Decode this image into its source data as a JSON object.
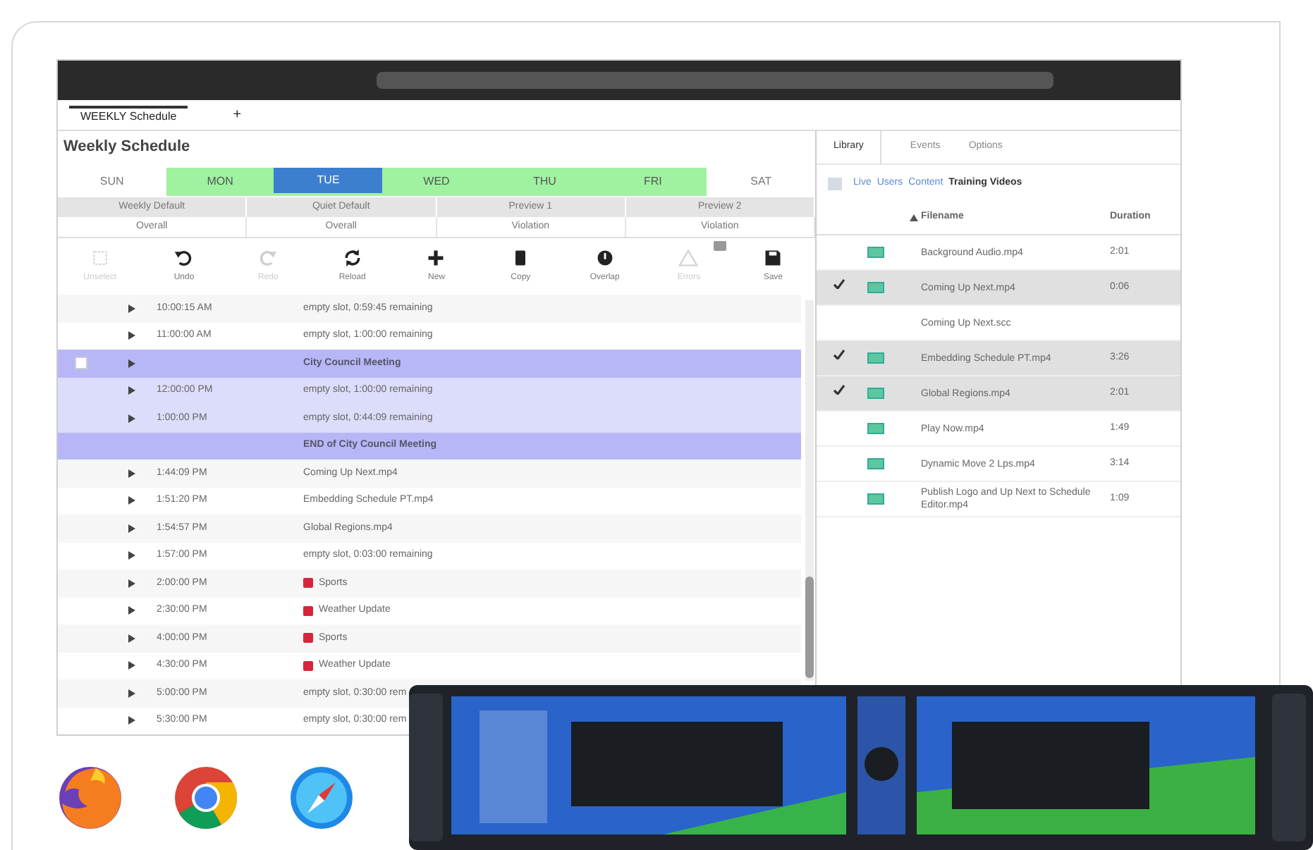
{
  "app_tabs": [
    {
      "label": "WEEKLY Schedule",
      "selected": true
    },
    {
      "label": "+",
      "selected": false
    }
  ],
  "schedule": {
    "title": "Weekly Schedule",
    "days": [
      {
        "label": "SUN",
        "selected": false,
        "scheduled": false
      },
      {
        "label": "MON",
        "selected": false,
        "scheduled": true
      },
      {
        "label": "TUE",
        "selected": true,
        "scheduled": true
      },
      {
        "label": "WED",
        "selected": false,
        "scheduled": true
      },
      {
        "label": "THU",
        "selected": false,
        "scheduled": true
      },
      {
        "label": "FRI",
        "selected": false,
        "scheduled": true
      },
      {
        "label": "SAT",
        "selected": false,
        "scheduled": false
      }
    ],
    "profiles": [
      "Weekly Default",
      "Quiet Default",
      "Preview 1",
      "Preview 2"
    ],
    "profile_states": [
      "Overall",
      "Overall",
      "Violation",
      "Violation"
    ],
    "toolbar": [
      {
        "label": "Unselect",
        "disabled": true
      },
      {
        "label": "Undo",
        "disabled": false
      },
      {
        "label": "Redo",
        "disabled": true
      },
      {
        "label": "Reload",
        "disabled": false
      },
      {
        "label": "New",
        "disabled": false
      },
      {
        "label": "Copy",
        "disabled": false
      },
      {
        "label": "Overlap",
        "disabled": false
      },
      {
        "label": "Errors",
        "disabled": true
      },
      {
        "label": "Save",
        "disabled": false
      }
    ],
    "rows": [
      {
        "kind": "item",
        "time": "10:00:15 AM",
        "title": "empty slot, 0:59:45 remaining",
        "flag": false
      },
      {
        "kind": "item",
        "time": "11:00:00 AM",
        "title": "empty slot, 1:00:00 remaining",
        "flag": false
      },
      {
        "kind": "block_start",
        "title": "City Council Meeting",
        "checked": false
      },
      {
        "kind": "block_item",
        "time": "12:00:00 PM",
        "title": "empty slot, 1:00:00 remaining",
        "flag": false
      },
      {
        "kind": "block_item",
        "time": "1:00:00 PM",
        "title": "empty slot, 0:44:09 remaining",
        "flag": false
      },
      {
        "kind": "block_end",
        "title": "END of City Council Meeting"
      },
      {
        "kind": "item",
        "time": "1:44:09 PM",
        "title": "Coming Up Next.mp4",
        "flag": false
      },
      {
        "kind": "item",
        "time": "1:51:20 PM",
        "title": "Embedding Schedule PT.mp4",
        "flag": false
      },
      {
        "kind": "item",
        "time": "1:54:57 PM",
        "title": "Global Regions.mp4",
        "flag": false
      },
      {
        "kind": "item",
        "time": "1:57:00 PM",
        "title": "empty slot, 0:03:00 remaining",
        "flag": false
      },
      {
        "kind": "item",
        "time": "2:00:00 PM",
        "title": "Sports",
        "flag": true
      },
      {
        "kind": "item",
        "time": "2:30:00 PM",
        "title": "Weather Update",
        "flag": true
      },
      {
        "kind": "item",
        "time": "4:00:00 PM",
        "title": "Sports",
        "flag": true
      },
      {
        "kind": "item",
        "time": "4:30:00 PM",
        "title": "Weather Update",
        "flag": true
      },
      {
        "kind": "item",
        "time": "5:00:00 PM",
        "title": "empty slot, 0:30:00 rem",
        "flag": false
      },
      {
        "kind": "item",
        "time": "5:30:00 PM",
        "title": "empty slot, 0:30:00 rem",
        "flag": false
      }
    ]
  },
  "library": {
    "tabs": [
      {
        "label": "Library",
        "selected": true
      },
      {
        "label": "Events",
        "selected": false
      },
      {
        "label": "Options",
        "selected": false
      }
    ],
    "breadcrumb": [
      "Live",
      "Users",
      "Content",
      "Training Videos"
    ],
    "columns": [
      "Filename",
      "Duration"
    ],
    "files": [
      {
        "name": "Background Audio.mp4",
        "duration": "2:01",
        "checked": false,
        "video": true
      },
      {
        "name": "Coming Up Next.mp4",
        "duration": "0:06",
        "checked": true,
        "video": true
      },
      {
        "name": "Coming Up Next.scc",
        "checked": false,
        "video": false
      },
      {
        "name": "Embedding Schedule PT.mp4",
        "duration": "3:26",
        "checked": true,
        "video": true
      },
      {
        "name": "Global Regions.mp4",
        "duration": "2:01",
        "checked": true,
        "video": true
      },
      {
        "name": "Play Now.mp4",
        "duration": "1:49",
        "checked": false,
        "video": true
      },
      {
        "name": "Dynamic Move 2 Lps.mp4",
        "duration": "3:14",
        "checked": false,
        "video": true
      },
      {
        "name": "Publish Logo and Up Next to Schedule Editor.mp4",
        "duration": "1:09",
        "checked": false,
        "video": true
      }
    ]
  }
}
